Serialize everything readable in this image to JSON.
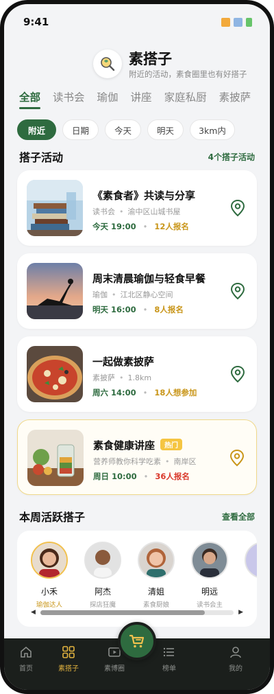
{
  "status_bar": {
    "time": "9:41"
  },
  "header": {
    "title": "素搭子",
    "subtitle": "附近的活动，素食圈里也有好搭子"
  },
  "category_tabs": [
    "全部",
    "读书会",
    "瑜伽",
    "讲座",
    "家庭私厨",
    "素披萨"
  ],
  "filters": [
    "附近",
    "日期",
    "今天",
    "明天",
    "3km内"
  ],
  "activities_section": {
    "title": "搭子活动",
    "count_link": "4个搭子活动"
  },
  "activities": [
    {
      "title": "《素食者》共读与分享",
      "category": "读书会",
      "location": "渝中区山城书屋",
      "when": "今天 19:00",
      "count": "12人报名",
      "badge": ""
    },
    {
      "title": "周末清晨瑜伽与轻食早餐",
      "category": "瑜伽",
      "location": "江北区静心空间",
      "when": "明天 16:00",
      "count": "8人报名",
      "badge": ""
    },
    {
      "title": "一起做素披萨",
      "category": "素披萨",
      "location": "1.8km",
      "when": "周六 14:00",
      "count": "18人想参加",
      "badge": ""
    },
    {
      "title": "素食健康讲座",
      "category": "营养师教你科学吃素",
      "location": "南岸区",
      "when": "周日 10:00",
      "count": "36人报名",
      "badge": "热门"
    }
  ],
  "partners_section": {
    "title": "本周活跃搭子",
    "link": "查看全部"
  },
  "partners": [
    {
      "name": "小禾",
      "role": "瑜伽达人"
    },
    {
      "name": "阿杰",
      "role": "探店狂魔"
    },
    {
      "name": "清姐",
      "role": "素食厨娘"
    },
    {
      "name": "明远",
      "role": "读书会主"
    }
  ],
  "partners_scroll": {
    "position": 0.78
  },
  "tab_bar": [
    {
      "label": "首页",
      "icon": "home-icon"
    },
    {
      "label": "素搭子",
      "icon": "grid-icon"
    },
    {
      "label": "素博圈",
      "icon": "video-icon"
    },
    {
      "label": "榜单",
      "icon": "list-icon"
    },
    {
      "label": "我的",
      "icon": "user-icon"
    }
  ],
  "colors": {
    "brand_green": "#2e6b3f",
    "accent_gold": "#e2b33f",
    "hot_red": "#d9382b"
  }
}
